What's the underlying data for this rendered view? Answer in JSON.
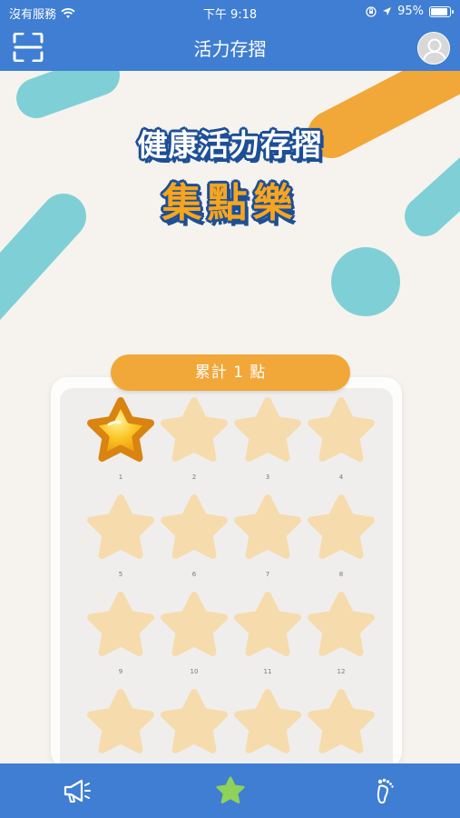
{
  "status_bar": {
    "carrier": "沒有服務",
    "time": "下午 9:18",
    "battery": "95%"
  },
  "nav": {
    "title": "活力存摺"
  },
  "hero": {
    "line1": "健康活力存摺",
    "line2": "集點樂"
  },
  "summary": {
    "total_label": "累計 1 點"
  },
  "stamps": [
    {
      "number": "1",
      "earned": true
    },
    {
      "number": "2",
      "earned": false
    },
    {
      "number": "3",
      "earned": false
    },
    {
      "number": "4",
      "earned": false
    },
    {
      "number": "5",
      "earned": false
    },
    {
      "number": "6",
      "earned": false
    },
    {
      "number": "7",
      "earned": false
    },
    {
      "number": "8",
      "earned": false
    },
    {
      "number": "9",
      "earned": false
    },
    {
      "number": "10",
      "earned": false
    },
    {
      "number": "11",
      "earned": false
    },
    {
      "number": "12",
      "earned": false
    },
    {
      "number": "",
      "earned": false
    },
    {
      "number": "",
      "earned": false
    },
    {
      "number": "",
      "earned": false
    },
    {
      "number": "",
      "earned": false
    }
  ],
  "tabs": [
    {
      "icon": "megaphone-icon"
    },
    {
      "icon": "star-icon",
      "active": true
    },
    {
      "icon": "footprint-icon"
    }
  ],
  "colors": {
    "primary": "#3f7ed2",
    "accent_orange": "#f2a739",
    "accent_teal": "#7fd0d6",
    "star_empty": "#f6dcad",
    "star_gold": "#f7b818",
    "tab_active": "#8fd15a"
  }
}
